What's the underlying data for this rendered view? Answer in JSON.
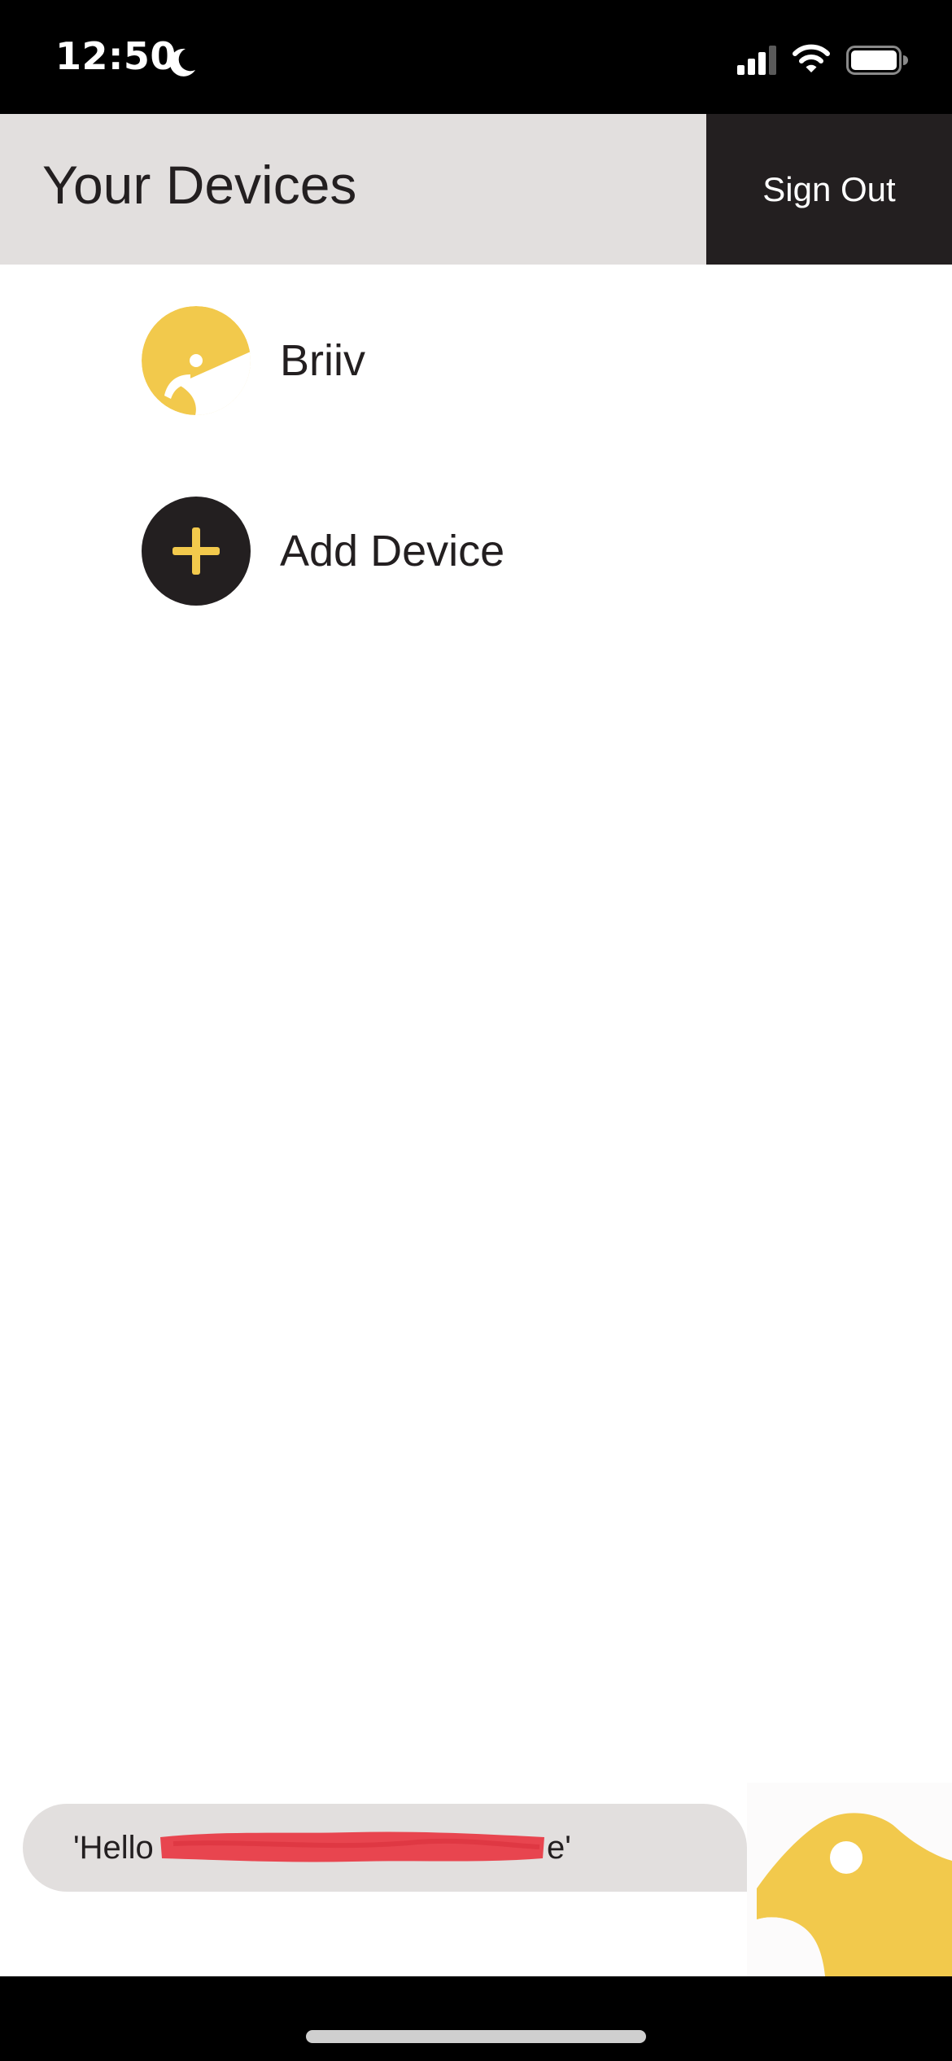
{
  "status_bar": {
    "time": "12:50",
    "icons": [
      "moon-icon",
      "signal-icon",
      "wifi-icon",
      "battery-icon"
    ]
  },
  "header": {
    "title": "Your Devices",
    "sign_out_label": "Sign Out"
  },
  "devices": [
    {
      "label": "Briiv",
      "icon": "briiv-bird-icon"
    },
    {
      "label": "Add Device",
      "icon": "plus-icon"
    }
  ],
  "message": {
    "text_visible_start": "'Hello",
    "text_visible_end": "e'",
    "redacted": true
  },
  "colors": {
    "brand_yellow": "#f2c94c",
    "dark": "#231f20",
    "header_gray": "#e2dfde",
    "redaction_red": "#e8454f"
  }
}
